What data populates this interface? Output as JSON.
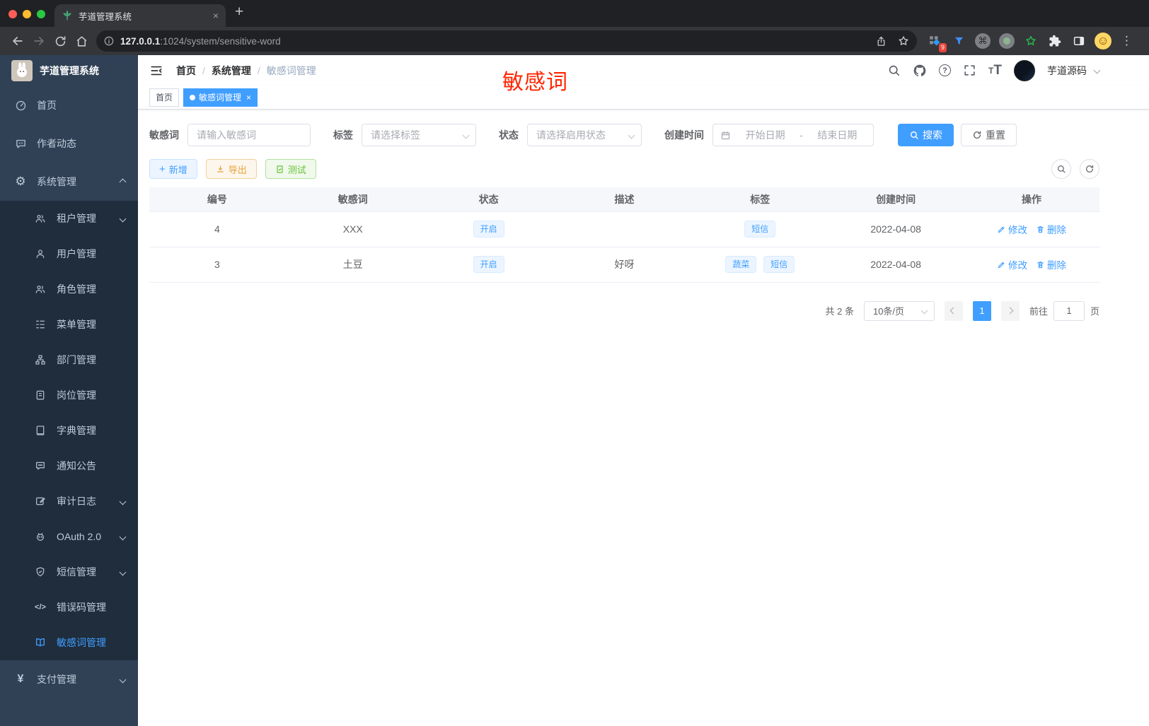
{
  "colors": {
    "accent": "#409eff",
    "warning": "#e6a23c",
    "success": "#67c23a",
    "watermark_red": "#ff2600",
    "sidebar_bg": "#304156",
    "submenu_bg": "#1f2d3d"
  },
  "icons": {
    "gear": "⚙",
    "cmd": "⌘",
    "dots": "⋮",
    "plus": "+",
    "new_tab": "+",
    "close": "×",
    "code": "</>",
    "yen": "¥",
    "question": "?",
    "smiley": "☺",
    "text_size_big": "T",
    "text_size_small": "T",
    "date_separator": "-"
  },
  "browser": {
    "tab": {
      "title": "芋道管理系统"
    },
    "toolbar": {
      "url_host": "127.0.0.1",
      "url_rest": ":1024/system/sensitive-word",
      "extension_badge": "9"
    }
  },
  "sidebar": {
    "logo_title": "芋道管理系统",
    "items": [
      {
        "label": "首页"
      },
      {
        "label": "作者动态"
      },
      {
        "label": "系统管理"
      },
      {
        "label": "租户管理"
      },
      {
        "label": "用户管理"
      },
      {
        "label": "角色管理"
      },
      {
        "label": "菜单管理"
      },
      {
        "label": "部门管理"
      },
      {
        "label": "岗位管理"
      },
      {
        "label": "字典管理"
      },
      {
        "label": "通知公告"
      },
      {
        "label": "审计日志"
      },
      {
        "label": "OAuth 2.0"
      },
      {
        "label": "短信管理"
      },
      {
        "label": "错误码管理"
      },
      {
        "label": "敏感词管理"
      },
      {
        "label": "支付管理"
      }
    ]
  },
  "navbar": {
    "breadcrumb": [
      "首页",
      "系统管理",
      "敏感词管理"
    ],
    "separator": "/",
    "username": "芋道源码"
  },
  "watermark": "敏感词",
  "tags_view": {
    "tabs": [
      {
        "label": "首页"
      },
      {
        "label": "敏感词管理"
      }
    ]
  },
  "filters": {
    "keyword": {
      "label": "敏感词",
      "placeholder": "请输入敏感词"
    },
    "tag": {
      "label": "标签",
      "placeholder": "请选择标签"
    },
    "status": {
      "label": "状态",
      "placeholder": "请选择启用状态"
    },
    "created": {
      "label": "创建时间",
      "start_placeholder": "开始日期",
      "end_placeholder": "结束日期"
    },
    "search_label": "搜索",
    "reset_label": "重置"
  },
  "actions_bar": {
    "add": "新增",
    "export": "导出",
    "test": "测试"
  },
  "table": {
    "headers": [
      "编号",
      "敏感词",
      "状态",
      "描述",
      "标签",
      "创建时间",
      "操作"
    ],
    "rows": [
      {
        "id": "4",
        "word": "XXX",
        "status": "开启",
        "description": "",
        "tags": [
          "短信"
        ],
        "created": "2022-04-08"
      },
      {
        "id": "3",
        "word": "土豆",
        "status": "开启",
        "description": "好呀",
        "tags": [
          "蔬菜",
          "短信"
        ],
        "created": "2022-04-08"
      }
    ],
    "edit_label": "修改",
    "delete_label": "删除"
  },
  "pagination": {
    "total": "共 2 条",
    "page_size": "10条/页",
    "current_page": "1",
    "goto_label": "前往",
    "goto_value": "1",
    "unit_label": "页"
  }
}
